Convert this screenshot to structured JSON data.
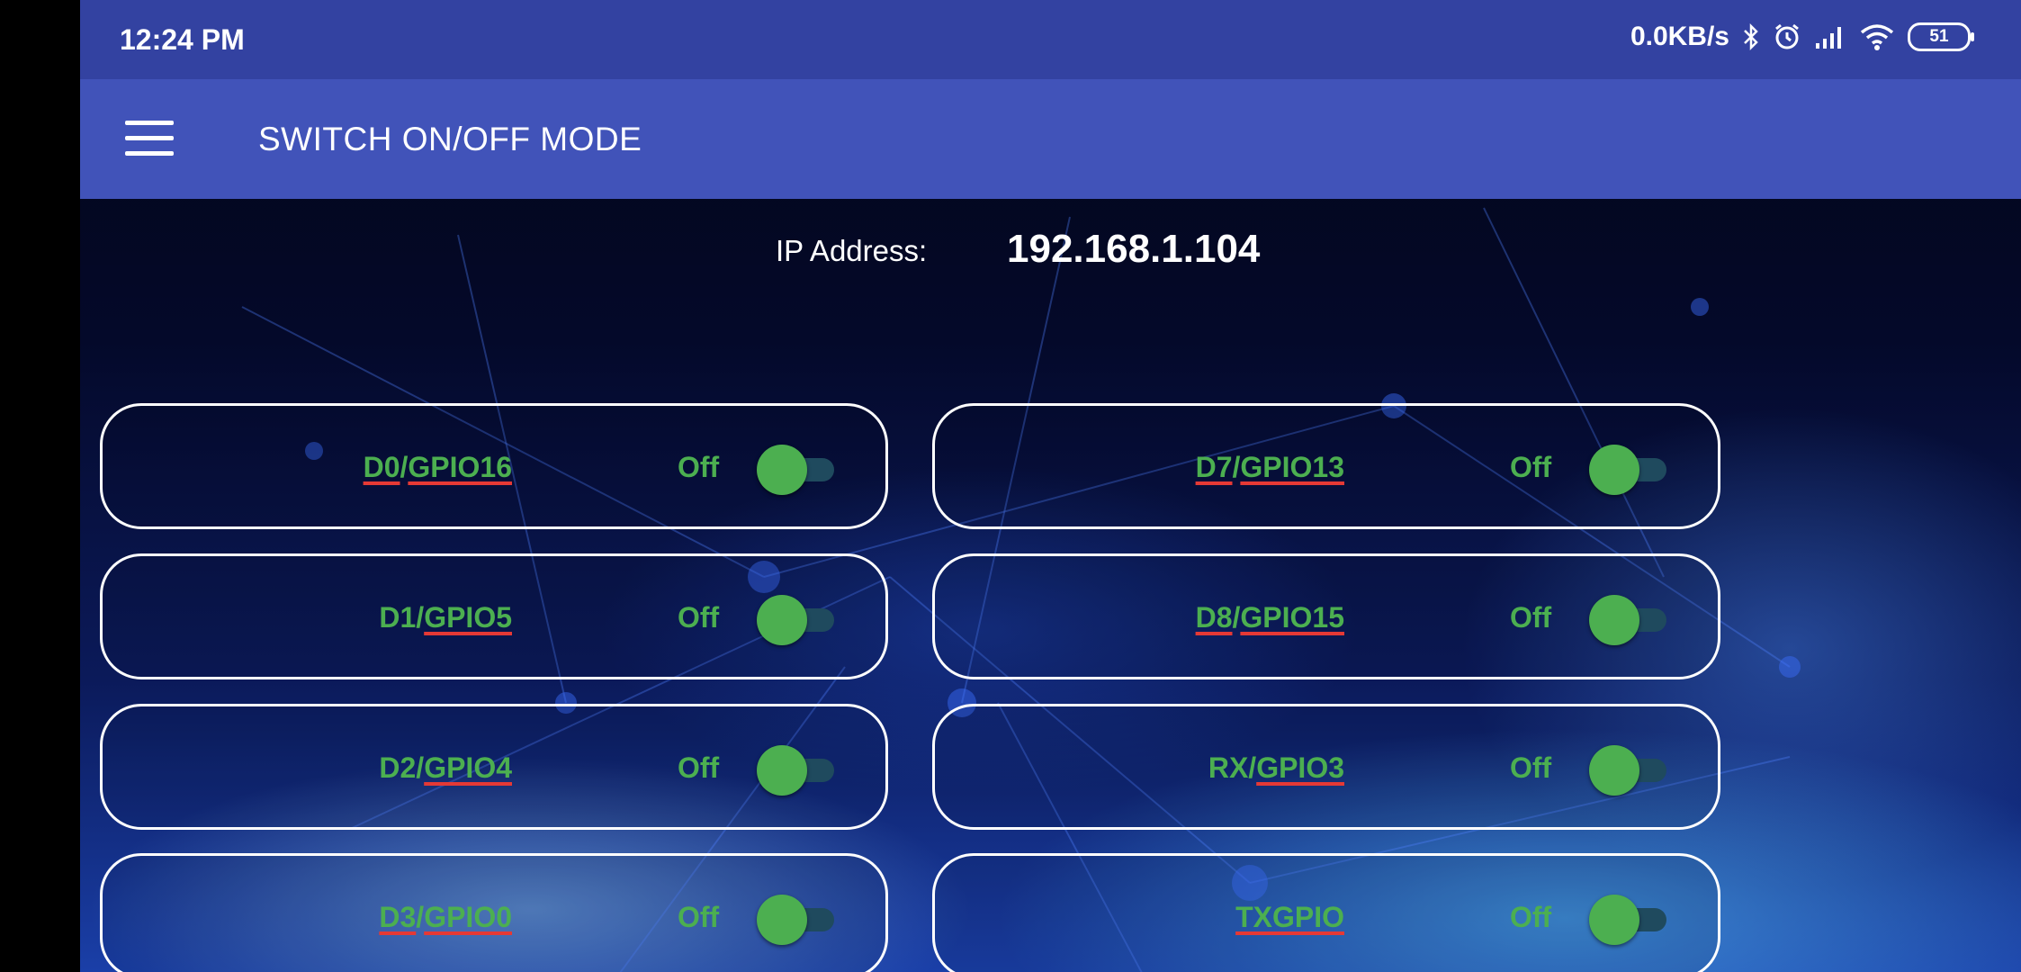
{
  "status_bar": {
    "time": "12:24 PM",
    "net_speed": "0.0KB/s",
    "battery": "51",
    "icons": [
      "bluetooth-icon",
      "alarm-icon",
      "signal-icon",
      "wifi-icon",
      "battery-icon"
    ]
  },
  "app_bar": {
    "menu_icon": "hamburger-menu-icon",
    "title": "SWITCH ON/OFF MODE",
    "color": "#4153b9"
  },
  "ip": {
    "label": "IP Address:",
    "value": "192.168.1.104"
  },
  "pins": [
    {
      "prefix": "D0",
      "sep": "/",
      "gpio": "GPIO16",
      "state": "Off",
      "on": false
    },
    {
      "prefix": "D1",
      "sep": "/",
      "gpio": "GPIO5",
      "state": "Off",
      "on": false
    },
    {
      "prefix": "D2",
      "sep": "/",
      "gpio": "GPIO4",
      "state": "Off",
      "on": false
    },
    {
      "prefix": "D3",
      "sep": "/",
      "gpio": "GPIO0",
      "state": "Off",
      "on": false
    },
    {
      "prefix": "D7",
      "sep": "/",
      "gpio": "GPIO13",
      "state": "Off",
      "on": false
    },
    {
      "prefix": "D8",
      "sep": "/",
      "gpio": "GPIO15",
      "state": "Off",
      "on": false
    },
    {
      "prefix": "RX",
      "sep": "/",
      "gpio": "GPIO3",
      "state": "Off",
      "on": false
    },
    {
      "prefix": "",
      "sep": "",
      "gpio": "TXGPIO",
      "state": "Off",
      "on": false
    }
  ],
  "colors": {
    "status_bar": "#3342a1",
    "label_green": "#4caf50",
    "underline_red": "#e53935"
  }
}
